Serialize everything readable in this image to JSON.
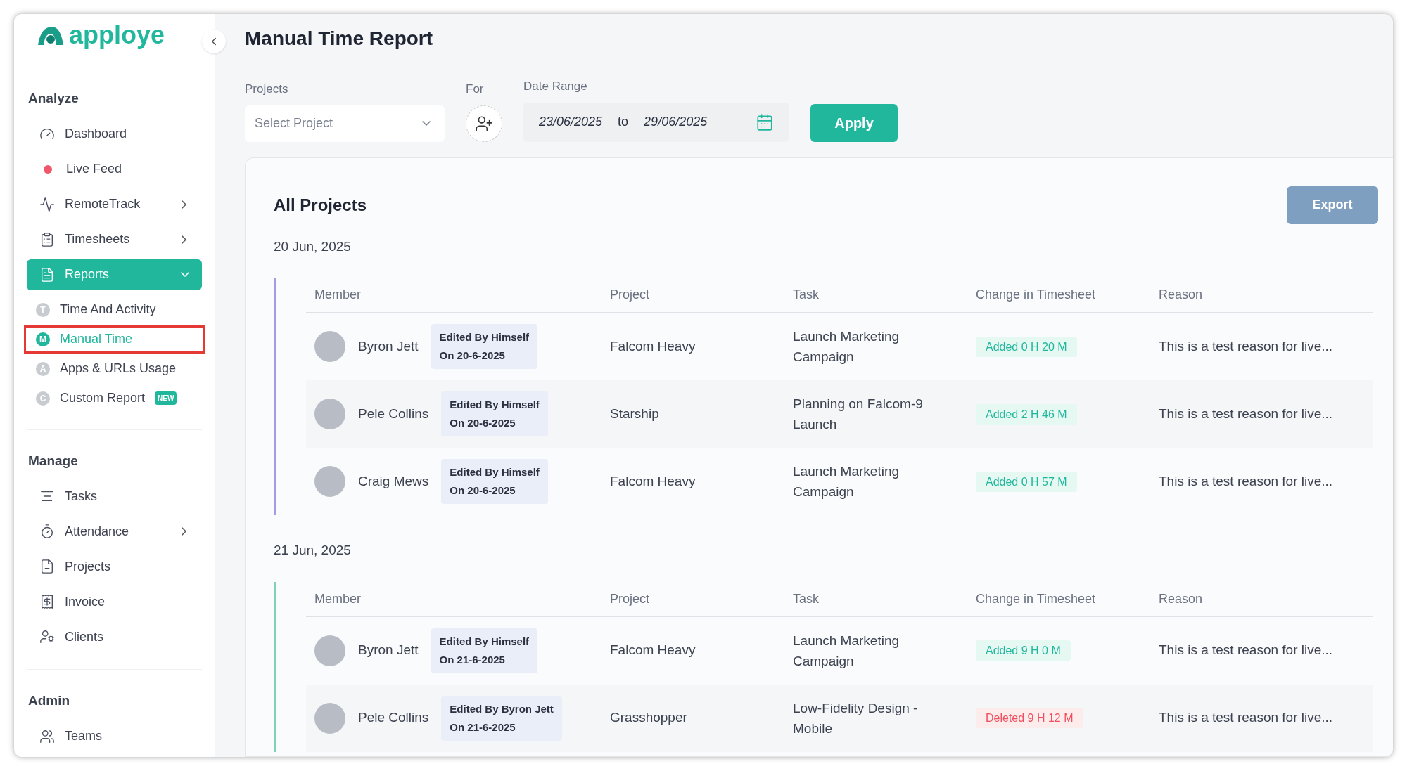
{
  "brand": {
    "name": "apploye"
  },
  "sidebar": {
    "sections": [
      {
        "title": "Analyze",
        "items": [
          {
            "label": "Dashboard",
            "kind": "gauge",
            "submenu": false
          },
          {
            "label": "Live Feed",
            "kind": "live",
            "submenu": false
          },
          {
            "label": "RemoteTrack",
            "kind": "pulse",
            "submenu": true
          },
          {
            "label": "Timesheets",
            "kind": "sheet",
            "submenu": true
          },
          {
            "label": "Reports",
            "kind": "report",
            "submenu": true,
            "expanded": true,
            "selected": true,
            "children": [
              {
                "letter": "T",
                "label": "Time And Activity",
                "selected": false,
                "highlighted": false
              },
              {
                "letter": "M",
                "label": "Manual Time",
                "selected": true,
                "highlighted": true
              },
              {
                "letter": "A",
                "label": "Apps & URLs Usage",
                "selected": false,
                "highlighted": false
              },
              {
                "letter": "C",
                "label": "Custom Report",
                "selected": false,
                "highlighted": false,
                "badge": "NEW"
              }
            ]
          }
        ]
      },
      {
        "title": "Manage",
        "items": [
          {
            "label": "Tasks",
            "kind": "list",
            "submenu": false
          },
          {
            "label": "Attendance",
            "kind": "clock",
            "submenu": true
          },
          {
            "label": "Projects",
            "kind": "file",
            "submenu": false
          },
          {
            "label": "Invoice",
            "kind": "invoice",
            "submenu": false
          },
          {
            "label": "Clients",
            "kind": "clients",
            "submenu": false
          }
        ]
      },
      {
        "title": "Admin",
        "items": [
          {
            "label": "Teams",
            "kind": "teams",
            "submenu": false
          }
        ]
      }
    ]
  },
  "page": {
    "title": "Manual Time Report"
  },
  "filters": {
    "projects": {
      "label": "Projects",
      "placeholder": "Select Project"
    },
    "for": {
      "label": "For"
    },
    "date_range": {
      "label": "Date Range",
      "from": "23/06/2025",
      "separator": "to",
      "to": "29/06/2025"
    },
    "apply": "Apply"
  },
  "report": {
    "title": "All Projects",
    "export": "Export",
    "groups": [
      {
        "date": "20 Jun, 2025",
        "color": "#a79be6",
        "columns": [
          "Member",
          "Project",
          "Task",
          "Change in Timesheet",
          "Reason"
        ],
        "rows": [
          {
            "member": "Byron Jett",
            "edited": "Edited By Himself",
            "edited_on": "On 20-6-2025",
            "project": "Falcom Heavy",
            "task": "Launch Marketing Campaign",
            "change": {
              "kind": "added",
              "text": "Added 0 H 20 M"
            },
            "reason": "This is a test reason for live..."
          },
          {
            "member": "Pele Collins",
            "edited": "Edited By Himself",
            "edited_on": "On 20-6-2025",
            "project": "Starship",
            "task": "Planning on Falcom-9 Launch",
            "change": {
              "kind": "added",
              "text": "Added 2 H 46 M"
            },
            "reason": "This is a test reason for live..."
          },
          {
            "member": "Craig Mews",
            "edited": "Edited By Himself",
            "edited_on": "On 20-6-2025",
            "project": "Falcom Heavy",
            "task": "Launch Marketing Campaign",
            "change": {
              "kind": "added",
              "text": "Added 0 H 57 M"
            },
            "reason": "This is a test reason for live..."
          }
        ]
      },
      {
        "date": "21 Jun, 2025",
        "color": "#7fd3b4",
        "columns": [
          "Member",
          "Project",
          "Task",
          "Change in Timesheet",
          "Reason"
        ],
        "rows": [
          {
            "member": "Byron Jett",
            "edited": "Edited By Himself",
            "edited_on": "On 21-6-2025",
            "project": "Falcom Heavy",
            "task": "Launch Marketing Campaign",
            "change": {
              "kind": "added",
              "text": "Added 9 H 0 M"
            },
            "reason": "This is a test reason for live..."
          },
          {
            "member": "Pele Collins",
            "edited": "Edited By Byron Jett",
            "edited_on": "On 21-6-2025",
            "project": "Grasshopper",
            "task": "Low-Fidelity Design - Mobile",
            "change": {
              "kind": "deleted",
              "text": "Deleted 9 H 12 M"
            },
            "reason": "This is a test reason for live..."
          }
        ]
      }
    ]
  }
}
